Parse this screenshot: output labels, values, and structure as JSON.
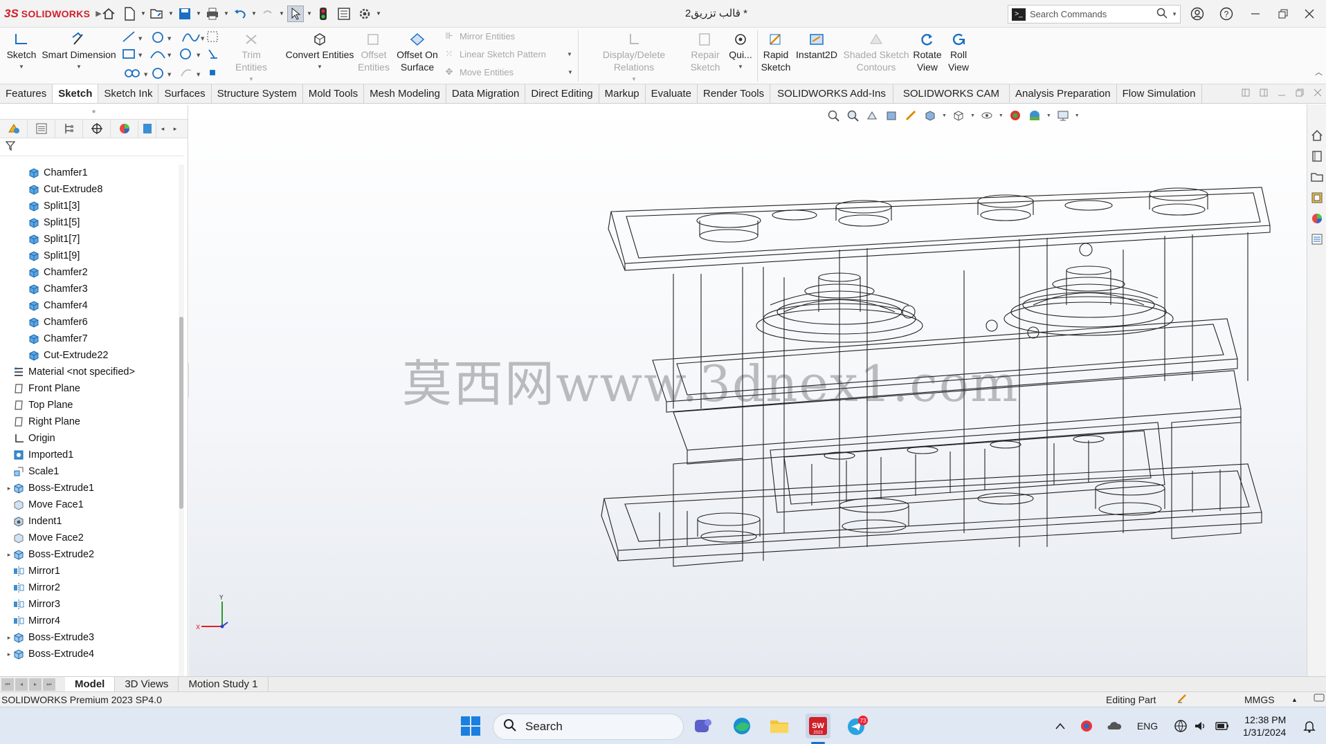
{
  "app": {
    "brand_ds": "3S",
    "brand_name": "SOLIDWORKS",
    "doc_title": "قالب تزریق2 *",
    "search_placeholder": "Search Commands"
  },
  "command_manager": {
    "sketch": "Sketch",
    "smart_dimension": "Smart Dimension",
    "trim_entities": "Trim Entities",
    "convert_entities": "Convert Entities",
    "offset_entities_1": "Offset",
    "offset_entities_2": "Entities",
    "offset_on_surface_1": "Offset On",
    "offset_on_surface_2": "Surface",
    "mirror_entities": "Mirror Entities",
    "linear_sketch_pattern": "Linear Sketch Pattern",
    "move_entities": "Move Entities",
    "display_delete_relations": "Display/Delete Relations",
    "repair_sketch_1": "Repair",
    "repair_sketch_2": "Sketch",
    "quick_snaps": "Qui...",
    "rapid_sketch_1": "Rapid",
    "rapid_sketch_2": "Sketch",
    "instant2d": "Instant2D",
    "shaded_sketch_1": "Shaded Sketch",
    "shaded_sketch_2": "Contours",
    "rotate_view_1": "Rotate",
    "rotate_view_2": "View",
    "roll_view_1": "Roll",
    "roll_view_2": "View"
  },
  "tabs": [
    "Features",
    "Sketch",
    "Sketch Ink",
    "Surfaces",
    "Structure System",
    "Mold Tools",
    "Mesh Modeling",
    "Data Migration",
    "Direct Editing",
    "Markup",
    "Evaluate",
    "Render Tools",
    "SOLIDWORKS Add-Ins",
    "SOLIDWORKS CAM",
    "Analysis Preparation",
    "Flow Simulation"
  ],
  "active_tab": "Sketch",
  "tree": [
    {
      "label": "Chamfer1",
      "icon": "feature-icon",
      "indent": 1
    },
    {
      "label": "Cut-Extrude8",
      "icon": "feature-icon",
      "indent": 1
    },
    {
      "label": "Split1[3]",
      "icon": "feature-icon",
      "indent": 1
    },
    {
      "label": "Split1[5]",
      "icon": "feature-icon",
      "indent": 1
    },
    {
      "label": "Split1[7]",
      "icon": "feature-icon",
      "indent": 1
    },
    {
      "label": "Split1[9]",
      "icon": "feature-icon",
      "indent": 1
    },
    {
      "label": "Chamfer2",
      "icon": "feature-icon",
      "indent": 1
    },
    {
      "label": "Chamfer3",
      "icon": "feature-icon",
      "indent": 1
    },
    {
      "label": "Chamfer4",
      "icon": "feature-icon",
      "indent": 1
    },
    {
      "label": "Chamfer6",
      "icon": "feature-icon",
      "indent": 1
    },
    {
      "label": "Chamfer7",
      "icon": "feature-icon",
      "indent": 1
    },
    {
      "label": "Cut-Extrude22",
      "icon": "feature-icon",
      "indent": 1
    },
    {
      "label": "Material <not specified>",
      "icon": "material-icon",
      "indent": 0
    },
    {
      "label": "Front Plane",
      "icon": "plane-icon",
      "indent": 0
    },
    {
      "label": "Top Plane",
      "icon": "plane-icon",
      "indent": 0
    },
    {
      "label": "Right Plane",
      "icon": "plane-icon",
      "indent": 0
    },
    {
      "label": "Origin",
      "icon": "origin-icon",
      "indent": 0
    },
    {
      "label": "Imported1",
      "icon": "imported-icon",
      "indent": 0
    },
    {
      "label": "Scale1",
      "icon": "scale-icon",
      "indent": 0
    },
    {
      "label": "Boss-Extrude1",
      "icon": "boss-icon",
      "indent": 0,
      "expandable": true
    },
    {
      "label": "Move Face1",
      "icon": "moveface-icon",
      "indent": 0
    },
    {
      "label": "Indent1",
      "icon": "indent-icon",
      "indent": 0
    },
    {
      "label": "Move Face2",
      "icon": "moveface-icon",
      "indent": 0
    },
    {
      "label": "Boss-Extrude2",
      "icon": "boss-icon",
      "indent": 0,
      "expandable": true
    },
    {
      "label": "Mirror1",
      "icon": "mirror-icon",
      "indent": 0
    },
    {
      "label": "Mirror2",
      "icon": "mirror-icon",
      "indent": 0
    },
    {
      "label": "Mirror3",
      "icon": "mirror-icon",
      "indent": 0
    },
    {
      "label": "Mirror4",
      "icon": "mirror-icon",
      "indent": 0
    },
    {
      "label": "Boss-Extrude3",
      "icon": "boss-icon",
      "indent": 0,
      "expandable": true
    },
    {
      "label": "Boss-Extrude4",
      "icon": "boss-icon",
      "indent": 0,
      "expandable": true
    }
  ],
  "watermark": "莫西网www.3dnex1.com",
  "triad": {
    "x": "X",
    "y": "Y"
  },
  "bottom_tabs": [
    "Model",
    "3D Views",
    "Motion Study 1"
  ],
  "status": {
    "product": "SOLIDWORKS Premium 2023 SP4.0",
    "mode": "Editing Part",
    "units": "MMGS"
  },
  "taskbar": {
    "search_label": "Search",
    "language": "ENG",
    "time": "12:38 PM",
    "date": "1/31/2024",
    "telegram_badge": "73",
    "sw_badge": "2023"
  },
  "colors": {
    "brand_red": "#d0202a",
    "accent_blue": "#1a6fc4",
    "feature_blue": "#3b8fd3"
  }
}
